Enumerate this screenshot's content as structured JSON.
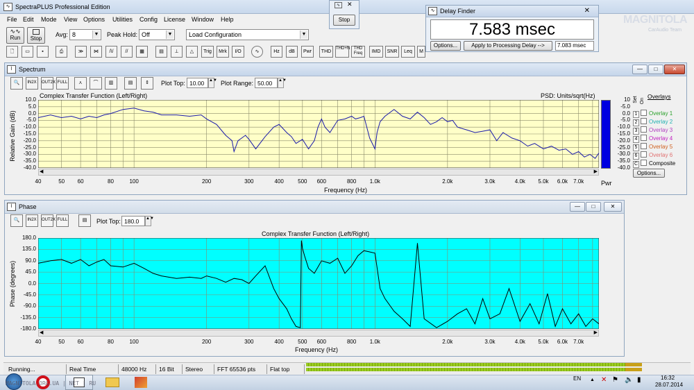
{
  "app": {
    "title": "SpectraPLUS Professional Edition"
  },
  "menu": [
    "File",
    "Edit",
    "Mode",
    "View",
    "Options",
    "Utilities",
    "Config",
    "License",
    "Window",
    "Help"
  ],
  "toolbar": {
    "run": "Run",
    "stop": "Stop",
    "avg_label": "Avg:",
    "avg_value": "8",
    "peak_label": "Peak Hold:",
    "peak_value": "Off",
    "load_config": "Load Configuration",
    "tools": [
      "Trig",
      "Mrk",
      "I/O",
      "Hz",
      "dB",
      "Pwr",
      "THD",
      "THD+N",
      "THD Freq",
      "IMD",
      "SNR",
      "Leq",
      "M"
    ]
  },
  "stop_popup": {
    "label": "Stop"
  },
  "delay": {
    "title": "Delay Finder",
    "value": "7.583 msec",
    "options": "Options...",
    "apply": "Apply to Processing Delay -->",
    "field": "7.083 msec"
  },
  "watermark": {
    "logo": "MAGNITOLA",
    "sub": "CarAudio Team"
  },
  "spectrum": {
    "window_title": "Spectrum",
    "plot_top_label": "Plot Top:",
    "plot_top": "10.00",
    "plot_range_label": "Plot Range:",
    "plot_range": "50.00",
    "chart_title": "Complex Transfer Function (Left/Right)",
    "psd": "PSD: Units/sqrt(Hz)",
    "ylabel": "Relative Gain (dB)",
    "xlabel": "Frequency (Hz)",
    "yticks": [
      "10.0",
      "5.0",
      "0.0",
      "-5.0",
      "-10.0",
      "-15.0",
      "-20.0",
      "-25.0",
      "-30.0",
      "-35.0",
      "-40.0"
    ],
    "right_ticks": [
      "10",
      "-5.0",
      "0.0",
      "-5.0",
      "-10.0",
      "-15.0",
      "-20.0",
      "-25.0",
      "-30.0",
      "-35.0",
      "-40.0"
    ],
    "pwr": "Pwr"
  },
  "phase": {
    "window_title": "Phase",
    "plot_top_label": "Plot Top:",
    "plot_top": "180.0",
    "chart_title": "Complex Transfer Function (Left/Right)",
    "ylabel": "Phase (degrees)",
    "xlabel": "Frequency (Hz)",
    "yticks": [
      "180.0",
      "135.0",
      "90.0",
      "45.0",
      "0.0",
      "-45.0",
      "-90.0",
      "-135.0",
      "-180.0"
    ]
  },
  "xticks": [
    "40",
    "50",
    "60",
    "80",
    "100",
    "200",
    "300",
    "400",
    "500",
    "600",
    "800",
    "1.0k",
    "2.0k",
    "3.0k",
    "4.0k",
    "5.0k",
    "6.0k",
    "7.0k"
  ],
  "overlays": {
    "title": "Overlays",
    "set": "Set",
    "on": "On",
    "options": "Options...",
    "composite": "Composite",
    "items": [
      {
        "n": "1",
        "label": "Overlay 1",
        "color": "#2aa02a"
      },
      {
        "n": "2",
        "label": "Overlay 2",
        "color": "#20b0b0"
      },
      {
        "n": "3",
        "label": "Overlay 3",
        "color": "#b040c0"
      },
      {
        "n": "4",
        "label": "Overlay 4",
        "color": "#c020c0"
      },
      {
        "n": "5",
        "label": "Overlay 5",
        "color": "#d06020"
      },
      {
        "n": "6",
        "label": "Overlay 6",
        "color": "#e07070"
      }
    ],
    "c": "C"
  },
  "status": [
    "Running...",
    "Real Time",
    "48000 Hz",
    "16 Bit",
    "Stereo",
    "FFT 65536 pts",
    "Flat top"
  ],
  "taskbar": {
    "lang": "EN",
    "time": "16:32",
    "date": "28.07.2014",
    "watermark": "MAGNITOLA.ORG.UA | NET | RU"
  },
  "colors": {
    "spectrum_bg": "#ffffc8",
    "phase_bg": "#00ffff",
    "trace_spectrum": "#1a1aaa",
    "trace_phase": "#000000",
    "meter": "#0000e0"
  },
  "chart_data": [
    {
      "type": "line",
      "title": "Complex Transfer Function (Left/Right)",
      "xlabel": "Frequency (Hz)",
      "ylabel": "Relative Gain (dB)",
      "xscale": "log",
      "xlim": [
        40,
        8500
      ],
      "ylim": [
        -40,
        10
      ],
      "series": [
        {
          "x": [
            40,
            45,
            50,
            55,
            60,
            65,
            70,
            75,
            80,
            90,
            100,
            110,
            120,
            130,
            150,
            170,
            190,
            200,
            220,
            240,
            255,
            260,
            270,
            290,
            300,
            320,
            350,
            380,
            400,
            430,
            450,
            470,
            500,
            530,
            560,
            580,
            600,
            620,
            650,
            700,
            750,
            800,
            830,
            870,
            900,
            950,
            1000,
            1020,
            1050,
            1100,
            1200,
            1300,
            1400,
            1500,
            1600,
            1700,
            1800,
            1900,
            2000,
            2100,
            2200,
            2400,
            2600,
            2800,
            3000,
            3200,
            3400,
            3700,
            4000,
            4300,
            4600,
            5000,
            5400,
            5800,
            6200,
            6600,
            7000,
            7400,
            7800,
            8200,
            8500
          ],
          "y": [
            -3,
            -1,
            -3,
            -2,
            -4,
            -2,
            -3,
            -1,
            0,
            3,
            4,
            2,
            1,
            -1,
            -1,
            -2,
            -1,
            -4,
            -8,
            -16,
            -20,
            -28,
            -20,
            -16,
            -19,
            -26,
            -17,
            -10,
            -8,
            -14,
            -17,
            -22,
            -19,
            -26,
            -20,
            -10,
            -4,
            -10,
            -14,
            -5,
            -4,
            -2,
            -4,
            -3,
            -2,
            -18,
            -26,
            -14,
            -6,
            -2,
            3,
            -2,
            -4,
            1,
            -3,
            -8,
            -6,
            -3,
            -6,
            -5,
            -10,
            -12,
            -14,
            -13,
            -12,
            -20,
            -14,
            -18,
            -20,
            -24,
            -22,
            -26,
            -24,
            -27,
            -26,
            -30,
            -28,
            -32,
            -30,
            -33,
            -29
          ]
        }
      ]
    },
    {
      "type": "line",
      "title": "Complex Transfer Function (Left/Right)",
      "xlabel": "Frequency (Hz)",
      "ylabel": "Phase (degrees)",
      "xscale": "log",
      "xlim": [
        40,
        8500
      ],
      "ylim": [
        -180,
        180
      ],
      "series": [
        {
          "x": [
            40,
            45,
            50,
            55,
            60,
            65,
            70,
            75,
            80,
            90,
            100,
            110,
            120,
            130,
            150,
            170,
            190,
            200,
            220,
            240,
            260,
            280,
            300,
            320,
            350,
            380,
            400,
            430,
            450,
            470,
            490,
            495,
            500,
            510,
            530,
            560,
            600,
            650,
            700,
            750,
            800,
            850,
            900,
            950,
            1000,
            1050,
            1100,
            1200,
            1300,
            1400,
            1500,
            1600,
            1800,
            2000,
            2200,
            2400,
            2600,
            2800,
            3000,
            3300,
            3600,
            4000,
            4400,
            4800,
            5200,
            5600,
            6000,
            6500,
            7000,
            7500,
            8000,
            8500
          ],
          "y": [
            80,
            90,
            95,
            80,
            95,
            70,
            85,
            95,
            70,
            65,
            80,
            60,
            40,
            30,
            20,
            25,
            20,
            30,
            20,
            5,
            20,
            15,
            0,
            30,
            70,
            -20,
            -60,
            -100,
            -140,
            -170,
            -175,
            170,
            140,
            110,
            60,
            40,
            90,
            80,
            100,
            40,
            70,
            110,
            130,
            125,
            120,
            -20,
            -60,
            -110,
            -140,
            -170,
            160,
            -140,
            -175,
            -150,
            -120,
            -100,
            -160,
            -60,
            -140,
            -120,
            -20,
            -150,
            -80,
            -160,
            -40,
            -170,
            -100,
            -160,
            -120,
            -170,
            -140,
            -160
          ]
        }
      ]
    }
  ]
}
